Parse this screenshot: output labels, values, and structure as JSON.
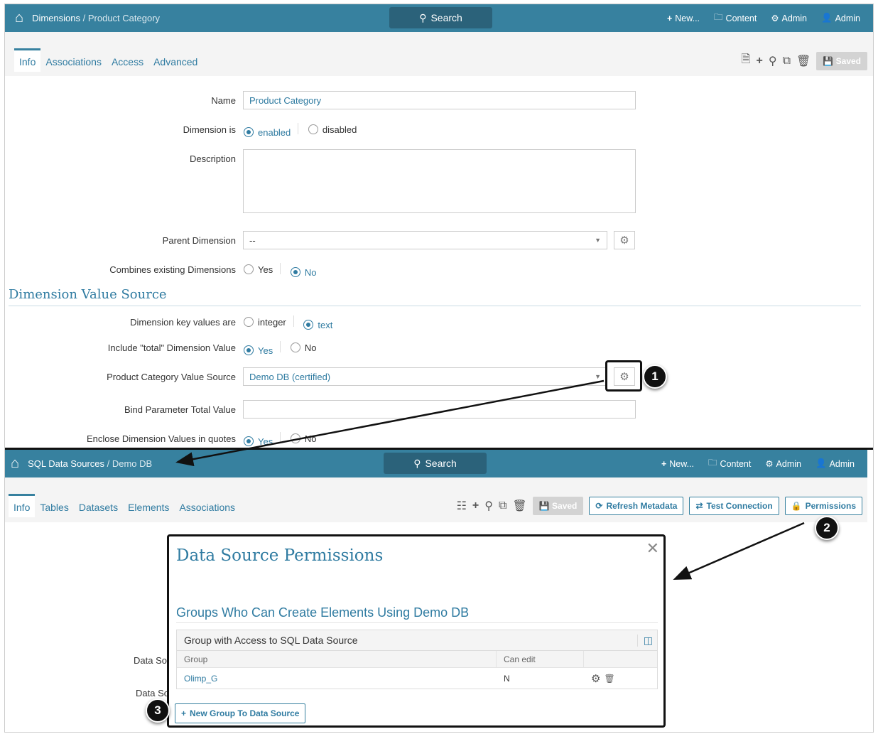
{
  "top": {
    "breadcrumb_parent": "Dimensions",
    "breadcrumb_sep": " / ",
    "breadcrumb_current": "Product Category",
    "search_label": "Search",
    "nav": {
      "new": "New...",
      "content": "Content",
      "admin_settings": "Admin",
      "user": "Admin"
    },
    "tabs": [
      "Info",
      "Associations",
      "Access",
      "Advanced"
    ],
    "saved_label": "Saved",
    "form": {
      "name_label": "Name",
      "name_value": "Product Category",
      "dimension_is_label": "Dimension is",
      "enabled": "enabled",
      "disabled": "disabled",
      "description_label": "Description",
      "description_value": "",
      "parent_label": "Parent Dimension",
      "parent_value": "--",
      "combines_label": "Combines existing Dimensions",
      "yes": "Yes",
      "no": "No",
      "section_title": "Dimension Value Source",
      "key_values_label": "Dimension key values are",
      "integer": "integer",
      "text": "text",
      "include_total_label": "Include \"total\" Dimension Value",
      "value_source_label": "Product Category Value Source",
      "value_source_value": "Demo DB (certified)",
      "bind_param_label": "Bind Parameter Total Value",
      "bind_param_value": "",
      "enclose_label": "Enclose Dimension Values in quotes"
    }
  },
  "bottom": {
    "breadcrumb_parent": "SQL Data Sources",
    "breadcrumb_sep": " / ",
    "breadcrumb_current": "Demo DB",
    "search_label": "Search",
    "nav": {
      "new": "New...",
      "content": "Content",
      "admin_settings": "Admin",
      "user": "Admin"
    },
    "tabs": [
      "Info",
      "Tables",
      "Datasets",
      "Elements",
      "Associations"
    ],
    "saved_label": "Saved",
    "refresh_label": "Refresh Metadata",
    "test_label": "Test Connection",
    "permissions_label": "Permissions",
    "bg_labels": [
      "Data So",
      "Data So"
    ],
    "modal": {
      "title": "Data Source Permissions",
      "subtitle": "Groups Who Can Create Elements Using Demo DB",
      "panel_title": "Group with Access to SQL Data Source",
      "columns": [
        "Group",
        "Can edit"
      ],
      "rows": [
        {
          "group": "Olimp_G",
          "can_edit": "N"
        }
      ],
      "add_button": "New Group To Data Source"
    }
  },
  "callouts": [
    "1",
    "2",
    "3"
  ]
}
